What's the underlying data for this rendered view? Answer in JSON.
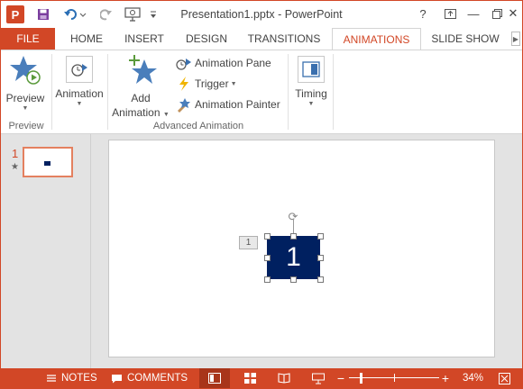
{
  "titlebar": {
    "title": "Presentation1.pptx - PowerPoint",
    "app_icon_letter": "P",
    "help": "?",
    "minimize": "—",
    "close": "✕"
  },
  "tabs": [
    {
      "label": "FILE"
    },
    {
      "label": "HOME"
    },
    {
      "label": "INSERT"
    },
    {
      "label": "DESIGN"
    },
    {
      "label": "TRANSITIONS"
    },
    {
      "label": "ANIMATIONS"
    },
    {
      "label": "SLIDE SHOW"
    }
  ],
  "ribbon": {
    "preview": {
      "label": "Preview",
      "group": "Preview"
    },
    "animation": {
      "label": "Animation"
    },
    "add_animation": {
      "label_line1": "Add",
      "label_line2": "Animation"
    },
    "animation_pane": {
      "label": "Animation Pane"
    },
    "trigger": {
      "label": "Trigger"
    },
    "animation_painter": {
      "label": "Animation Painter"
    },
    "advanced_group": "Advanced Animation",
    "timing": {
      "label": "Timing"
    }
  },
  "slides_pane": {
    "slide_number": "1",
    "star": "★"
  },
  "slide": {
    "shape_text": "1",
    "animation_tag": "1"
  },
  "statusbar": {
    "notes": "NOTES",
    "comments": "COMMENTS",
    "zoom": "34%"
  },
  "colors": {
    "accent": "#d24726",
    "shape_fill": "#002060"
  }
}
